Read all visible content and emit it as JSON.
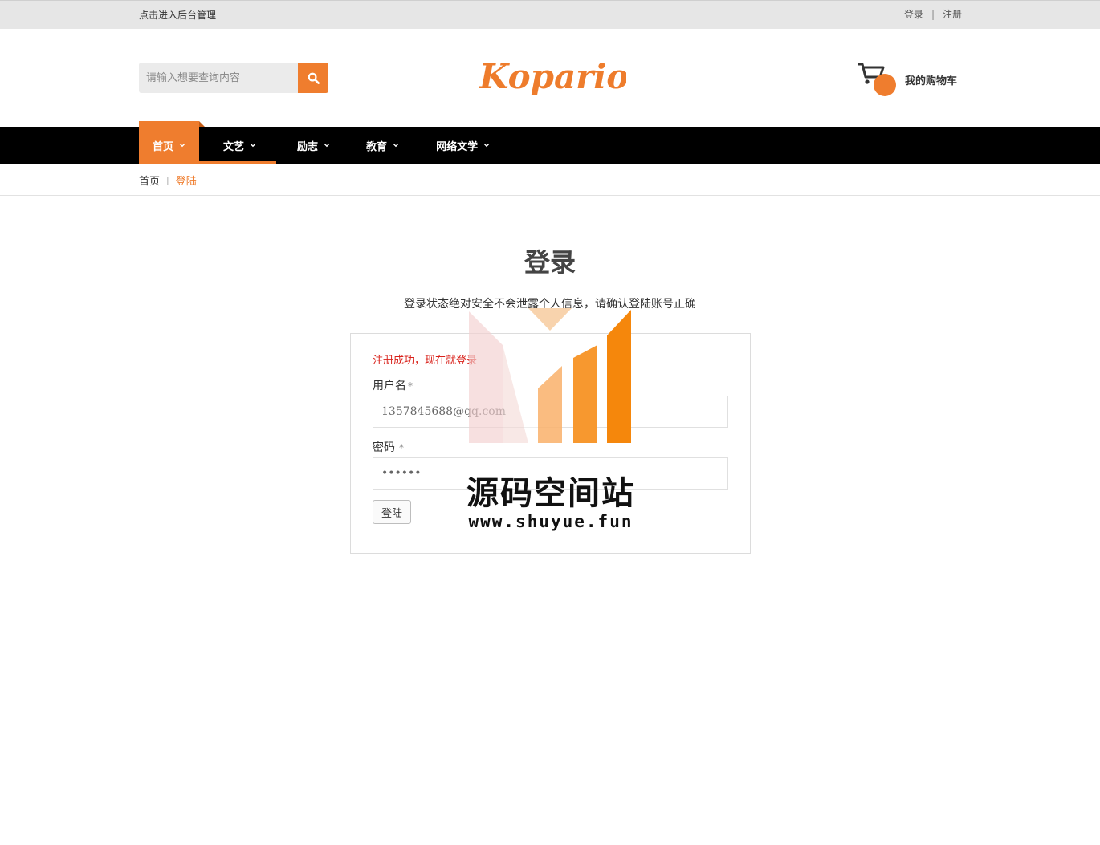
{
  "topbar": {
    "admin_link": "点击进入后台管理",
    "login": "登录",
    "separator": "|",
    "register": "注册"
  },
  "header": {
    "search_placeholder": "请输入想要查询内容",
    "search_icon": "search-icon",
    "logo_text": "Koparion",
    "cart_label": "我的购物车",
    "cart_icon": "shopping-cart-icon"
  },
  "nav": {
    "items": [
      {
        "label": "首页"
      },
      {
        "label": "文艺"
      },
      {
        "label": "励志"
      },
      {
        "label": "教育"
      },
      {
        "label": "网络文学"
      }
    ]
  },
  "breadcrumb": {
    "home": "首页",
    "separator": "|",
    "current": "登陆"
  },
  "main": {
    "title": "登录",
    "subtitle": "登录状态绝对安全不会泄露个人信息，请确认登陆账号正确"
  },
  "login_form": {
    "success_message": "注册成功，现在就登录",
    "username_label": "用户名",
    "required_mark": "*",
    "username_value": "1357845688@qq.com",
    "password_label": "密码",
    "password_value": "••••••",
    "submit_label": "登陆"
  },
  "watermark": {
    "text": "源码空间站",
    "url": "www.shuyue.fun"
  },
  "colors": {
    "accent": "#ef7d2e",
    "nav_background": "#000000",
    "topbar_background": "#e6e6e6",
    "error_text": "#d9221b"
  }
}
